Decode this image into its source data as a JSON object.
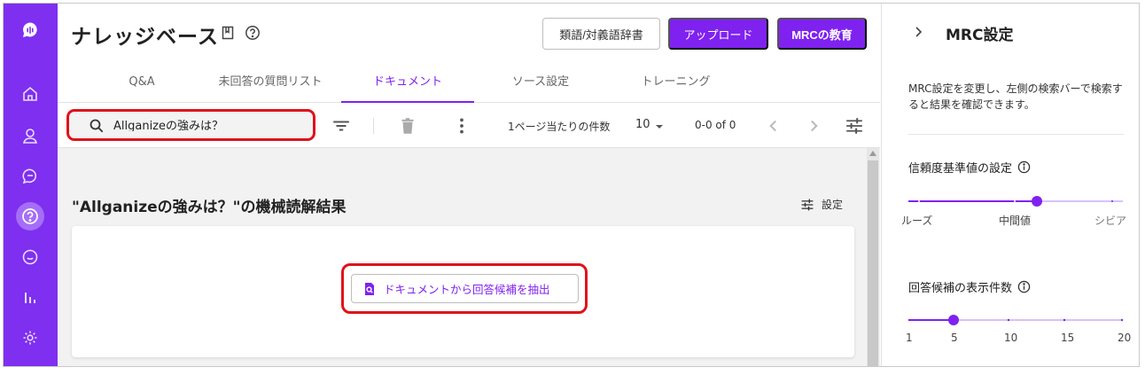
{
  "header": {
    "title": "ナレッジベース",
    "buttons": {
      "dictionary": "類語/対義語辞書",
      "upload": "アップロード",
      "mrc_training": "MRCの教育"
    }
  },
  "tabs": [
    {
      "label": "Q&A"
    },
    {
      "label": "未回答の質問リスト"
    },
    {
      "label": "ドキュメント",
      "active": true
    },
    {
      "label": "ソース設定"
    },
    {
      "label": "トレーニング"
    }
  ],
  "toolbar": {
    "search_value": "Allganizeの強みは？",
    "rows_per_page_label": "1ページ当たりの件数",
    "rows_per_page_value": "10",
    "page_range": "0-0 of 0"
  },
  "content": {
    "result_title": "\"Allganizeの強みは？\"の機械読解結果",
    "settings_label": "設定",
    "extract_button": "ドキュメントから回答候補を抽出"
  },
  "panel": {
    "title": "MRC設定",
    "description": "MRC設定を変更し、左側の検索バーで検索すると結果を確認できます。",
    "confidence": {
      "title": "信頼度基準値の設定",
      "labels": [
        "ルーズ",
        "中間値",
        "シビア"
      ],
      "value_fraction": 0.6
    },
    "answer_count": {
      "title": "回答候補の表示件数",
      "ticks": [
        "1",
        "5",
        "10",
        "15",
        "20"
      ],
      "value": 5
    }
  },
  "colors": {
    "brand": "#7f22f0",
    "rail": "#7f2ff0",
    "highlight": "#e0121a"
  },
  "icons": {
    "rail": [
      "logo-icon",
      "home-icon",
      "user-icon",
      "chat-icon",
      "question-icon",
      "bubble-icon",
      "analytics-icon",
      "settings-icon"
    ]
  }
}
